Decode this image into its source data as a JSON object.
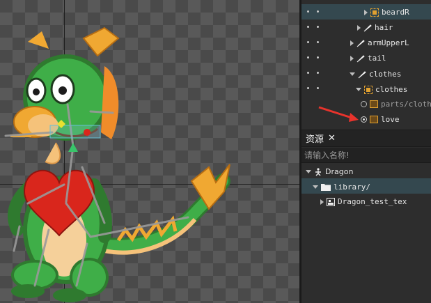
{
  "hierarchy": {
    "rows": [
      {
        "label": "beardR",
        "icon": "image-node-icon"
      },
      {
        "label": "hair",
        "icon": "bone-icon"
      },
      {
        "label": "armUpperL",
        "icon": "bone-icon"
      },
      {
        "label": "tail",
        "icon": "bone-icon"
      },
      {
        "label": "clothes",
        "icon": "bone-icon"
      },
      {
        "label": "clothes",
        "icon": "image-node-icon"
      },
      {
        "label": "parts/cloth",
        "icon": "picture-icon"
      },
      {
        "label": "love",
        "icon": "picture-icon"
      }
    ]
  },
  "assets": {
    "title": "资源",
    "close_glyph": "✕",
    "search_placeholder": "请输入名称!",
    "items": [
      {
        "label": "Dragon",
        "icon": "armature-icon"
      },
      {
        "label": "library/",
        "icon": "folder-icon"
      },
      {
        "label": "Dragon_test_tex",
        "icon": "texture-icon"
      }
    ]
  },
  "colors": {
    "selection": "#34484f",
    "annotation_arrow": "#e8332c",
    "panel_bg": "#2d2d2d"
  }
}
